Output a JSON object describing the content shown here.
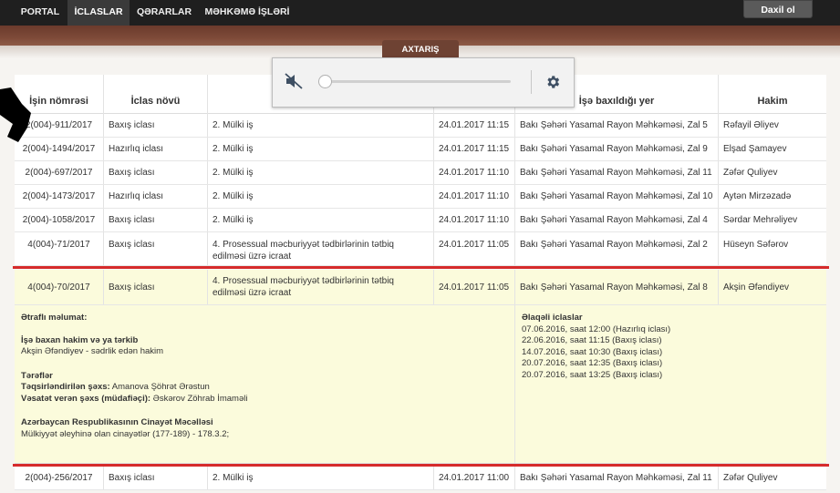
{
  "nav": {
    "items": [
      "PORTAL",
      "İCLASLAR",
      "QƏRARLAR",
      "MƏHKƏMƏ İŞLƏRİ"
    ],
    "login_label": "Daxil ol"
  },
  "search_tab": "AXTARIŞ",
  "table": {
    "headers": [
      "İşin nömrəsi",
      "İclas növü",
      "",
      "",
      "İşə baxıldığı yer",
      "Hakim"
    ],
    "rows": [
      [
        "2(004)-911/2017",
        "Baxış iclası",
        "2. Mülki iş",
        "24.01.2017 11:15",
        "Bakı Şəhəri Yasamal Rayon Məhkəməsi, Zal 5",
        "Rəfayil Əliyev"
      ],
      [
        "2(004)-1494/2017",
        "Hazırlıq iclası",
        "2. Mülki iş",
        "24.01.2017 11:15",
        "Bakı Şəhəri Yasamal Rayon Məhkəməsi, Zal 9",
        "Elşad Şamayev"
      ],
      [
        "2(004)-697/2017",
        "Baxış iclası",
        "2. Mülki iş",
        "24.01.2017 11:10",
        "Bakı Şəhəri Yasamal Rayon Məhkəməsi, Zal 11",
        "Zəfər Quliyev"
      ],
      [
        "2(004)-1473/2017",
        "Hazırlıq iclası",
        "2. Mülki iş",
        "24.01.2017 11:10",
        "Bakı Şəhəri Yasamal Rayon Məhkəməsi, Zal 10",
        "Aytən Mirzəzadə"
      ],
      [
        "2(004)-1058/2017",
        "Baxış iclası",
        "2. Mülki iş",
        "24.01.2017 11:10",
        "Bakı Şəhəri Yasamal Rayon Məhkəməsi, Zal 4",
        "Sərdar Mehrəliyev"
      ],
      [
        "4(004)-71/2017",
        "Baxış iclası",
        "4. Prosessual məcburiyyət tədbirlərinin tətbiq edilməsi üzrə icraat",
        "24.01.2017 11:05",
        "Bakı Şəhəri Yasamal Rayon Məhkəməsi, Zal 2",
        "Hüseyn Səfərov"
      ],
      [
        "4(004)-70/2017",
        "Baxış iclası",
        "4. Prosessual məcburiyyət tədbirlərinin tətbiq edilməsi üzrə icraat",
        "24.01.2017 11:05",
        "Bakı Şəhəri Yasamal Rayon Məhkəməsi, Zal 8",
        "Akşin Əfəndiyev"
      ],
      [
        "2(004)-256/2017",
        "Baxış iclası",
        "2. Mülki iş",
        "24.01.2017 11:00",
        "Bakı Şəhəri Yasamal Rayon Məhkəməsi, Zal 11",
        "Zəfər Quliyev"
      ]
    ]
  },
  "details": {
    "title": "Ətraflı məlumat:",
    "judge_heading": "İşə baxan hakim və ya tərkib",
    "judge_value": "Akşin Əfəndiyev - sədrlik edən hakim",
    "parties_heading": "Tərəflər",
    "accused_label": "Təqsirləndirilən şəxs:",
    "accused_value": " Amanova Şöhrət Ərəstun",
    "petitioner_label": "Vəsatət verən şəxs (müdafiəçi):",
    "petitioner_value": " Əskərov Zöhrab İmaməli",
    "code_heading": "Azərbaycan Respublikasının Cinayət Məcəlləsi",
    "code_value": "Mülkiyyət əleyhinə olan cinayətlər (177-189) - 178.3.2;",
    "related_heading": "Əlaqəli iclaslar",
    "related": [
      "07.06.2016, saat 12:00 (Hazırlıq iclası)",
      "22.06.2016, saat 11:15 (Baxış iclası)",
      "14.07.2016, saat 10:30 (Baxış iclası)",
      "20.07.2016, saat 12:35 (Baxış iclası)",
      "20.07.2016, saat 13:25 (Baxış iclası)"
    ]
  },
  "media_popup": {
    "mute_icon": "speaker-muted-icon",
    "settings_icon": "gear-icon",
    "volume": 0
  },
  "colors": {
    "navbar": "#1f1f1f",
    "band": "#7d4a38",
    "highlight": "#fbfbdc",
    "red_line": "#d62b2b"
  }
}
